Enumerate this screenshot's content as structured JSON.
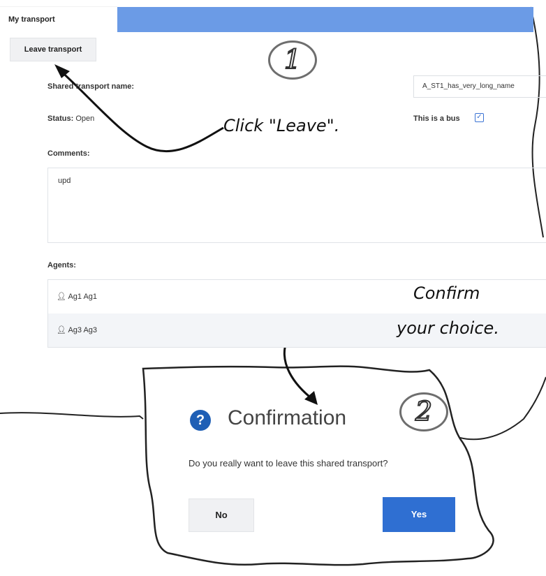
{
  "tab": {
    "label": "My transport"
  },
  "toolbar": {
    "leave_label": "Leave transport"
  },
  "form": {
    "shared_name_label": "Shared transport name:",
    "shared_name_value": "A_ST1_has_very_long_name",
    "status_label": "Status:",
    "status_value": "Open",
    "bus_label": "This is a bus",
    "bus_checked": "☑",
    "comments_label": "Comments:",
    "comments_value": "upd",
    "agents_label": "Agents:",
    "agents": [
      "Ag1 Ag1",
      "Ag3 Ag3"
    ]
  },
  "annotations": {
    "step1": "1",
    "step2": "2",
    "click_leave": "Click \"Leave\".",
    "confirm_line1": "Confirm",
    "confirm_line2": "your choice."
  },
  "dialog": {
    "title": "Confirmation",
    "message": "Do you really want to leave this shared transport?",
    "no_label": "No",
    "yes_label": "Yes"
  },
  "colors": {
    "header_blue": "#6b9be6",
    "yes_blue": "#2f6fd2",
    "help_blue": "#1f5fb5"
  },
  "icons": {
    "agent": "person-icon",
    "help": "help-icon",
    "checkbox": "checkbox-checked-icon"
  }
}
